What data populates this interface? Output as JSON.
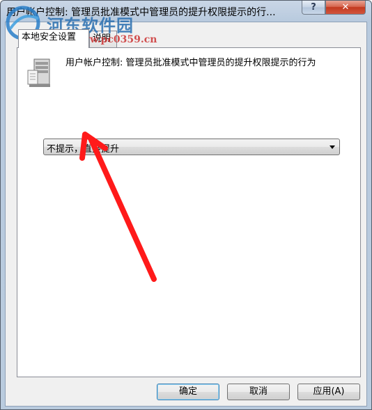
{
  "window": {
    "title": "用户帐户控制: 管理员批准模式中管理员的提升权限提示的行...",
    "help_label": "?",
    "close_label": "✕"
  },
  "tabs": [
    {
      "label": "本地安全设置"
    },
    {
      "label": "说明"
    }
  ],
  "policy": {
    "icon": "server-icon",
    "description": "用户帐户控制: 管理员批准模式中管理员的提升权限提示的行为"
  },
  "dropdown": {
    "selected": "不提示，直接提升"
  },
  "buttons": {
    "ok": "确定",
    "cancel": "取消",
    "apply": "应用(A)"
  },
  "watermark": {
    "brand": "河东软件园",
    "url": "www.pc0359.cn"
  },
  "annotation": {
    "arrow_color": "#ff1a1a"
  }
}
